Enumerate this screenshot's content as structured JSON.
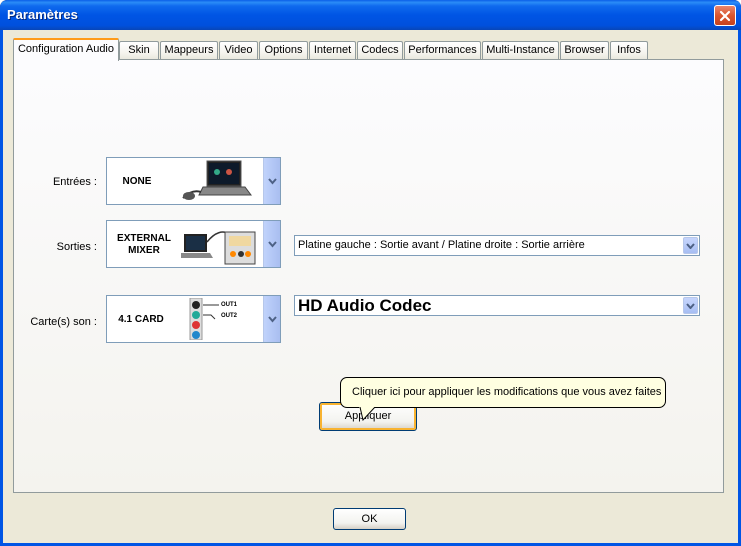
{
  "window": {
    "title": "Paramètres"
  },
  "tabs": [
    {
      "label": "Configuration Audio",
      "active": true
    },
    {
      "label": "Skin"
    },
    {
      "label": "Mappeurs"
    },
    {
      "label": "Video"
    },
    {
      "label": "Options"
    },
    {
      "label": "Internet"
    },
    {
      "label": "Codecs"
    },
    {
      "label": "Performances"
    },
    {
      "label": "Multi-Instance"
    },
    {
      "label": "Browser"
    },
    {
      "label": "Infos"
    }
  ],
  "inputs": {
    "label": "Entrées :",
    "device": "NONE"
  },
  "outputs": {
    "label": "Sorties :",
    "device_line1": "EXTERNAL",
    "device_line2": "MIXER",
    "routing": "Platine gauche : Sortie avant / Platine droite : Sortie arrière"
  },
  "soundcard": {
    "label": "Carte(s) son :",
    "device": "4.1 CARD",
    "out1": "OUT1",
    "out2": "OUT2",
    "codec": "HD Audio Codec"
  },
  "apply": {
    "label": "Appliquer",
    "tooltip": "Cliquer ici pour appliquer les modifications que vous avez faites"
  },
  "ok": {
    "label": "OK"
  },
  "colors": {
    "titlebar": "#0055E5",
    "panel": "#ECE9D8",
    "tooltip": "#FFFFE1",
    "focus": "#F8B330"
  }
}
